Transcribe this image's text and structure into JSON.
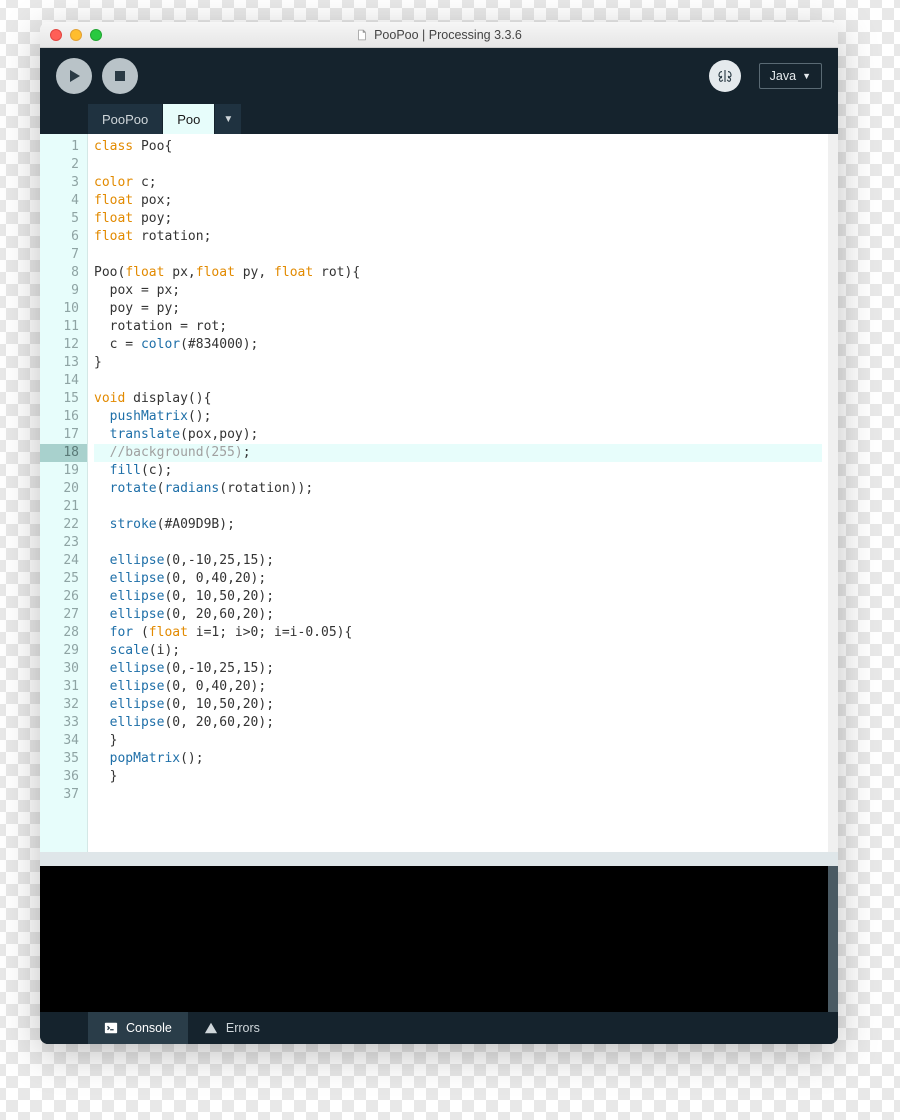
{
  "window": {
    "title": "PooPoo | Processing 3.3.6"
  },
  "toolbar": {
    "language": "Java",
    "dropdown_glyph": "▼"
  },
  "tabs": [
    {
      "label": "PooPoo",
      "active": false
    },
    {
      "label": "Poo",
      "active": true
    },
    {
      "label": "▼",
      "active": false
    }
  ],
  "code": {
    "highlight_line": 18,
    "lines": [
      [
        [
          "kw-t",
          "class"
        ],
        [
          "",
          " Poo{"
        ]
      ],
      [],
      [
        [
          "kw-t",
          "color"
        ],
        [
          "",
          " c;"
        ]
      ],
      [
        [
          "kw-t",
          "float"
        ],
        [
          "",
          " pox;"
        ]
      ],
      [
        [
          "kw-t",
          "float"
        ],
        [
          "",
          " poy;"
        ]
      ],
      [
        [
          "kw-t",
          "float"
        ],
        [
          "",
          " rotation;"
        ]
      ],
      [],
      [
        [
          "",
          "Poo("
        ],
        [
          "kw-t",
          "float"
        ],
        [
          "",
          " px,"
        ],
        [
          "kw-t",
          "float"
        ],
        [
          "",
          " py, "
        ],
        [
          "kw-t",
          "float"
        ],
        [
          "",
          " rot){"
        ]
      ],
      [
        [
          "",
          "  pox = px;"
        ]
      ],
      [
        [
          "",
          "  poy = py;"
        ]
      ],
      [
        [
          "",
          "  rotation = rot;"
        ]
      ],
      [
        [
          "",
          "  c = "
        ],
        [
          "kw-b",
          "color"
        ],
        [
          "",
          "(#834000);"
        ]
      ],
      [
        [
          "",
          "}"
        ]
      ],
      [],
      [
        [
          "kw-t",
          "void"
        ],
        [
          "",
          " display(){"
        ]
      ],
      [
        [
          "",
          "  "
        ],
        [
          "kw-b",
          "pushMatrix"
        ],
        [
          "",
          "();"
        ]
      ],
      [
        [
          "",
          "  "
        ],
        [
          "kw-b",
          "translate"
        ],
        [
          "",
          "(pox,poy);"
        ]
      ],
      [
        [
          "",
          "  "
        ],
        [
          "cm",
          "//background(255)"
        ],
        [
          "",
          ";"
        ]
      ],
      [
        [
          "",
          "  "
        ],
        [
          "kw-b",
          "fill"
        ],
        [
          "",
          "(c);"
        ]
      ],
      [
        [
          "",
          "  "
        ],
        [
          "kw-b",
          "rotate"
        ],
        [
          "",
          "("
        ],
        [
          "kw-b",
          "radians"
        ],
        [
          "",
          "(rotation));"
        ]
      ],
      [],
      [
        [
          "",
          "  "
        ],
        [
          "kw-b",
          "stroke"
        ],
        [
          "",
          "(#A09D9B);"
        ]
      ],
      [],
      [
        [
          "",
          "  "
        ],
        [
          "kw-b",
          "ellipse"
        ],
        [
          "",
          "(0,-10,25,15);"
        ]
      ],
      [
        [
          "",
          "  "
        ],
        [
          "kw-b",
          "ellipse"
        ],
        [
          "",
          "(0, 0,40,20);"
        ]
      ],
      [
        [
          "",
          "  "
        ],
        [
          "kw-b",
          "ellipse"
        ],
        [
          "",
          "(0, 10,50,20);"
        ]
      ],
      [
        [
          "",
          "  "
        ],
        [
          "kw-b",
          "ellipse"
        ],
        [
          "",
          "(0, 20,60,20);"
        ]
      ],
      [
        [
          "",
          "  "
        ],
        [
          "kw-f",
          "for"
        ],
        [
          "",
          " ("
        ],
        [
          "kw-t",
          "float"
        ],
        [
          "",
          " i=1; i>0; i=i-0.05){"
        ]
      ],
      [
        [
          "",
          "  "
        ],
        [
          "kw-b",
          "scale"
        ],
        [
          "",
          "(i);"
        ]
      ],
      [
        [
          "",
          "  "
        ],
        [
          "kw-b",
          "ellipse"
        ],
        [
          "",
          "(0,-10,25,15);"
        ]
      ],
      [
        [
          "",
          "  "
        ],
        [
          "kw-b",
          "ellipse"
        ],
        [
          "",
          "(0, 0,40,20);"
        ]
      ],
      [
        [
          "",
          "  "
        ],
        [
          "kw-b",
          "ellipse"
        ],
        [
          "",
          "(0, 10,50,20);"
        ]
      ],
      [
        [
          "",
          "  "
        ],
        [
          "kw-b",
          "ellipse"
        ],
        [
          "",
          "(0, 20,60,20);"
        ]
      ],
      [
        [
          "",
          "  }"
        ]
      ],
      [
        [
          "",
          "  "
        ],
        [
          "kw-b",
          "popMatrix"
        ],
        [
          "",
          "();"
        ]
      ],
      [
        [
          "",
          "  }"
        ]
      ],
      []
    ]
  },
  "bottom": {
    "console": "Console",
    "errors": "Errors"
  }
}
